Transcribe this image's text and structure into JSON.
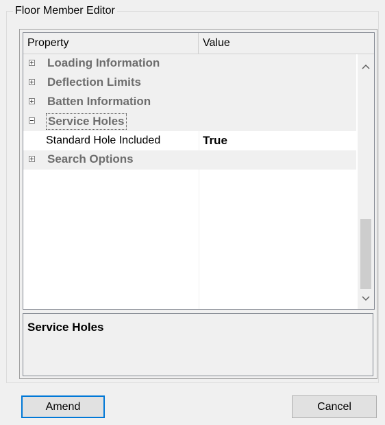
{
  "group": {
    "title": "Floor Member Editor"
  },
  "grid": {
    "header": {
      "property": "Property",
      "value": "Value"
    },
    "rows": [
      {
        "type": "category",
        "expanded": false,
        "label": "Loading Information"
      },
      {
        "type": "category",
        "expanded": false,
        "label": "Deflection Limits"
      },
      {
        "type": "category",
        "expanded": false,
        "label": "Batten Information"
      },
      {
        "type": "category",
        "expanded": true,
        "selected": true,
        "label": "Service Holes"
      },
      {
        "type": "item",
        "label": "Standard Hole Included",
        "value": "True"
      },
      {
        "type": "category",
        "expanded": false,
        "label": "Search Options"
      }
    ],
    "scrollbar": {
      "up_icon": "chevron-up-icon",
      "down_icon": "chevron-down-icon"
    }
  },
  "description": {
    "title": "Service Holes"
  },
  "buttons": {
    "amend": "Amend",
    "cancel": "Cancel"
  },
  "colors": {
    "focus_border": "#0078d7",
    "category_text": "#6d6d6d"
  }
}
